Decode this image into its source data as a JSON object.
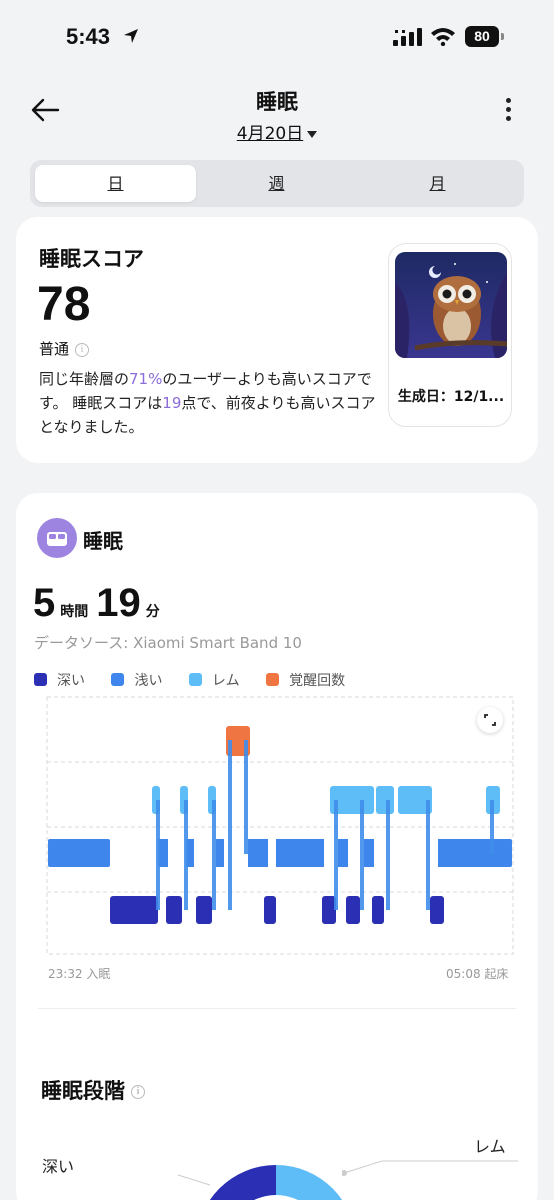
{
  "status_bar": {
    "time": "5:43",
    "battery": "80"
  },
  "header": {
    "title": "睡眠",
    "date": "4月20日"
  },
  "tabs": [
    {
      "label": "日",
      "active": true
    },
    {
      "label": "週",
      "active": false
    },
    {
      "label": "月",
      "active": false
    }
  ],
  "score_card": {
    "title": "睡眠スコア",
    "score": "78",
    "level": "普通",
    "desc_1": "同じ年齢層の",
    "desc_pct": "71%",
    "desc_2": "のユーザーよりも高いスコアです。 睡眠スコアは",
    "desc_pts": "19",
    "desc_3": "点で、前夜よりも高いスコアとなりました。",
    "image_date": "生成日：12/1..."
  },
  "sleep_card": {
    "title": "睡眠",
    "hours": "5",
    "hours_unit": "時間",
    "minutes": "19",
    "minutes_unit": "分",
    "source": "データソース: Xiaomi Smart Band 10",
    "legend": [
      {
        "label": "深い",
        "color": "#2b2fb4"
      },
      {
        "label": "浅い",
        "color": "#3e86ec"
      },
      {
        "label": "レム",
        "color": "#5ebcf6"
      },
      {
        "label": "覚醒回数",
        "color": "#ef7642"
      }
    ],
    "start_label": "23:32 入眠",
    "end_label": "05:08 起床"
  },
  "stages": {
    "title": "睡眠段階",
    "label_deep": "深い",
    "label_rem": "レム"
  }
}
